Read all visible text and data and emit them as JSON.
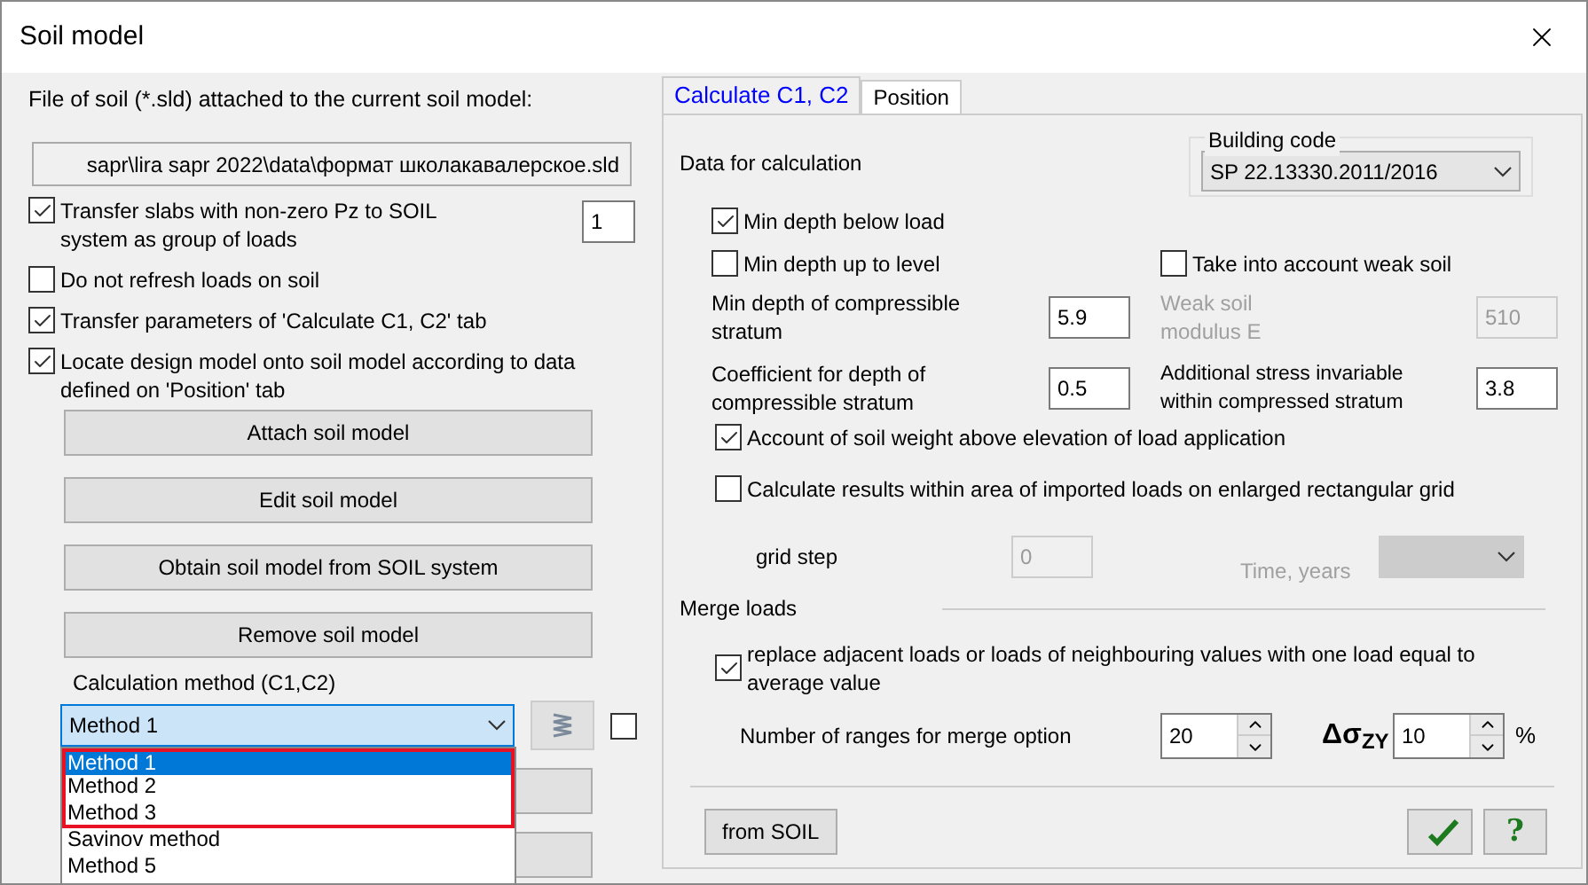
{
  "window": {
    "title": "Soil model"
  },
  "file": {
    "label": "File of soil (*.sld) attached to the current soil model:",
    "path": "sapr\\lira sapr 2022\\data\\формат школакавалерское.sld"
  },
  "options": [
    {
      "label": "Transfer slabs with non-zero Pz to SOIL system as group of loads",
      "checked": true,
      "value": "1"
    },
    {
      "label": "Do not refresh loads on soil",
      "checked": false
    },
    {
      "label": "Transfer parameters of 'Calculate C1, C2' tab",
      "checked": true
    },
    {
      "label": "Locate design model onto soil model according to data defined on 'Position' tab",
      "checked": true
    }
  ],
  "buttons": [
    "Attach soil model",
    "Edit soil model",
    "Obtain soil model from SOIL system",
    "Remove soil model"
  ],
  "method": {
    "label": "Calculation method (C1,C2)",
    "value": "Method 1",
    "extra_checked": false,
    "list": [
      {
        "label": "Method 1",
        "selected": true,
        "highlighted": true
      },
      {
        "label": "Method 2",
        "selected": false,
        "highlighted": true
      },
      {
        "label": "Method 3",
        "selected": false,
        "highlighted": true
      },
      {
        "label": "Savinov method",
        "selected": false,
        "highlighted": false
      },
      {
        "label": "Method 5",
        "selected": false,
        "highlighted": false
      }
    ]
  },
  "tabs": [
    {
      "label": "Calculate C1, C2",
      "selected": true
    },
    {
      "label": "Position",
      "selected": false
    }
  ],
  "calc": {
    "heading": "Data for calculation",
    "building_code": {
      "label": "Building code",
      "value": "SP 22.13330.2011/2016"
    },
    "min_depth_below": {
      "label": "Min depth below load",
      "checked": true
    },
    "min_depth_level": {
      "label": "Min depth up to level",
      "checked": false
    },
    "weak_soil": {
      "label": "Take into account weak soil",
      "checked": false
    },
    "min_depth_stratum": {
      "label": "Min depth of compressible stratum",
      "value": "5.9"
    },
    "weak_modulus": {
      "label": "Weak soil modulus E",
      "value": "510",
      "disabled": true
    },
    "coef_depth": {
      "label": "Coefficient for depth of compressible stratum",
      "value": "0.5"
    },
    "add_stress": {
      "label": "Additional stress invariable within compressed stratum",
      "value": "3.8"
    },
    "soil_weight": {
      "label": "Account of soil weight above elevation of load application",
      "checked": true
    },
    "enlarged_grid": {
      "label": "Calculate results within area of imported loads on enlarged rectangular grid",
      "checked": false
    },
    "grid_step": {
      "label": "grid step",
      "value": "0",
      "disabled": true
    },
    "time": {
      "label": "Time, years",
      "disabled": true
    }
  },
  "merge": {
    "heading": "Merge loads",
    "replace": {
      "label": "replace adjacent loads or loads of neighbouring values with one load equal to average value",
      "checked": true
    },
    "ranges": {
      "label": "Number of ranges for merge option",
      "value": "20"
    },
    "delta": {
      "label": "Δσ$_{ZY}$",
      "value": "10",
      "unit": "%"
    }
  },
  "footer": {
    "from_soil": "from SOIL",
    "help": "?"
  }
}
